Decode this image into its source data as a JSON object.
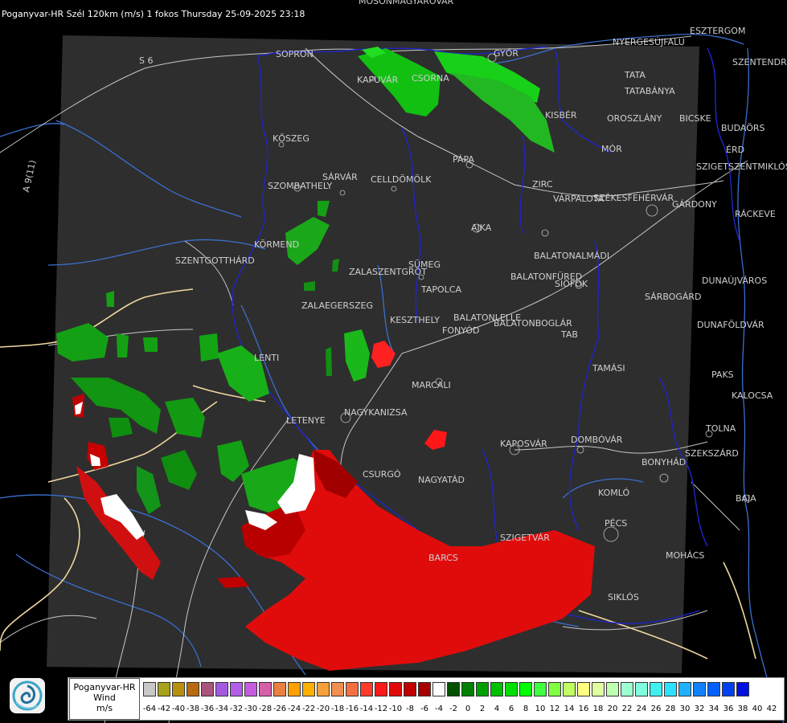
{
  "header": {
    "title": "Poganyvar-HR Szél 120km (m/s) 1 fokos Thursday 25-09-2025 23:18"
  },
  "map": {
    "colors": {
      "background": "#000000",
      "radar_area": "#2e2e2e",
      "border_line": "#1f25c8",
      "road_line": "#d9d9d9",
      "motorway_line": "#efd8a0",
      "river_line": "#3a6fcf",
      "label_text": "#cfcfcf"
    },
    "place_labels": [
      "MOSONMAGYARÓVÁR",
      "SOPRON",
      "KAPUVÁR",
      "CSORNA",
      "GYŐR",
      "NYERGESÚJFALU",
      "ESZTERGOM",
      "SZENTENDRE",
      "TATA",
      "TATABÁNYA",
      "KISBÉR",
      "OROSZLÁNY",
      "BICSKE",
      "BUDAÖRS",
      "MÓR",
      "ÉRD",
      "SZIGETSZENTMIKLÓS",
      "PÁPA",
      "KŐSZEG",
      "SZOMBATHELY",
      "SÁRVÁR",
      "CELLDÖMÖLK",
      "ZIRC",
      "VÁRPALOTA",
      "SZÉKESFEHÉRVÁR",
      "GÁRDONY",
      "RÁCKEVE",
      "AJKA",
      "KÖRMEND",
      "SZENTGOTTHÁRD",
      "BALATONALMÁDI",
      "SÜMEG",
      "ZALASZENTGRÓT",
      "BALATONFÜRED",
      "TAPOLCA",
      "SIÓFOK",
      "DUNAÚJVÁROS",
      "SÁRBOGÁRD",
      "ZALAEGERSZEG",
      "KESZTHELY",
      "BALATONLELLE",
      "FONYÓD",
      "BALATONBOGLÁR",
      "DUNAFÖLDVÁR",
      "TAB",
      "LENTI",
      "TAMÁSI",
      "PAKS",
      "MARCALI",
      "KALOCSA",
      "LETENYE",
      "NAGYKANIZSA",
      "KAPOSVÁR",
      "DOMBÓVÁR",
      "TOLNA",
      "SZEKSZÁRD",
      "CSURGÓ",
      "NAGYATÁD",
      "BONYHÁD",
      "KOMLÓ",
      "BAJA",
      "PÉCS",
      "SZIGETVÁR",
      "MOHÁCS",
      "BARCS",
      "SIKLÓS"
    ],
    "road_labels": [
      "S 6",
      "A 9(11)"
    ]
  },
  "legend": {
    "station": "Poganyvar-HR",
    "quantity": "Wind",
    "unit": "m/s",
    "swatch_colors": [
      "#c8c8c8",
      "#a7a11b",
      "#b98f10",
      "#b86a10",
      "#a9547a",
      "#a25ae0",
      "#b35ee8",
      "#c65ce0",
      "#d65faa",
      "#e98040",
      "#ffa000",
      "#ffb000",
      "#f5a03a",
      "#f09050",
      "#f57040",
      "#ff3a2a",
      "#ff1818",
      "#e00a0a",
      "#c00000",
      "#a80000",
      "#ffffff",
      "#005000",
      "#008000",
      "#00a000",
      "#00c000",
      "#00e000",
      "#00ff00",
      "#40ff40",
      "#80ff40",
      "#c0ff60",
      "#ffff80",
      "#e0ffa0",
      "#c0ffb0",
      "#a0ffd0",
      "#80ffe0",
      "#40f0f0",
      "#30e0ff",
      "#20b0ff",
      "#1080ff",
      "#0060ff",
      "#0040f0",
      "#0010e0"
    ],
    "tick_labels": [
      "-64",
      "-42",
      "-40",
      "-38",
      "-36",
      "-34",
      "-32",
      "-30",
      "-28",
      "-26",
      "-24",
      "-22",
      "-20",
      "-18",
      "-16",
      "-14",
      "-12",
      "-10",
      "-8",
      "-6",
      "-4",
      "-2",
      "0",
      "2",
      "4",
      "6",
      "8",
      "10",
      "12",
      "14",
      "16",
      "18",
      "20",
      "22",
      "24",
      "26",
      "28",
      "30",
      "32",
      "34",
      "36",
      "38",
      "40",
      "42"
    ],
    "logo_icon": "swirl-logo-icon"
  }
}
